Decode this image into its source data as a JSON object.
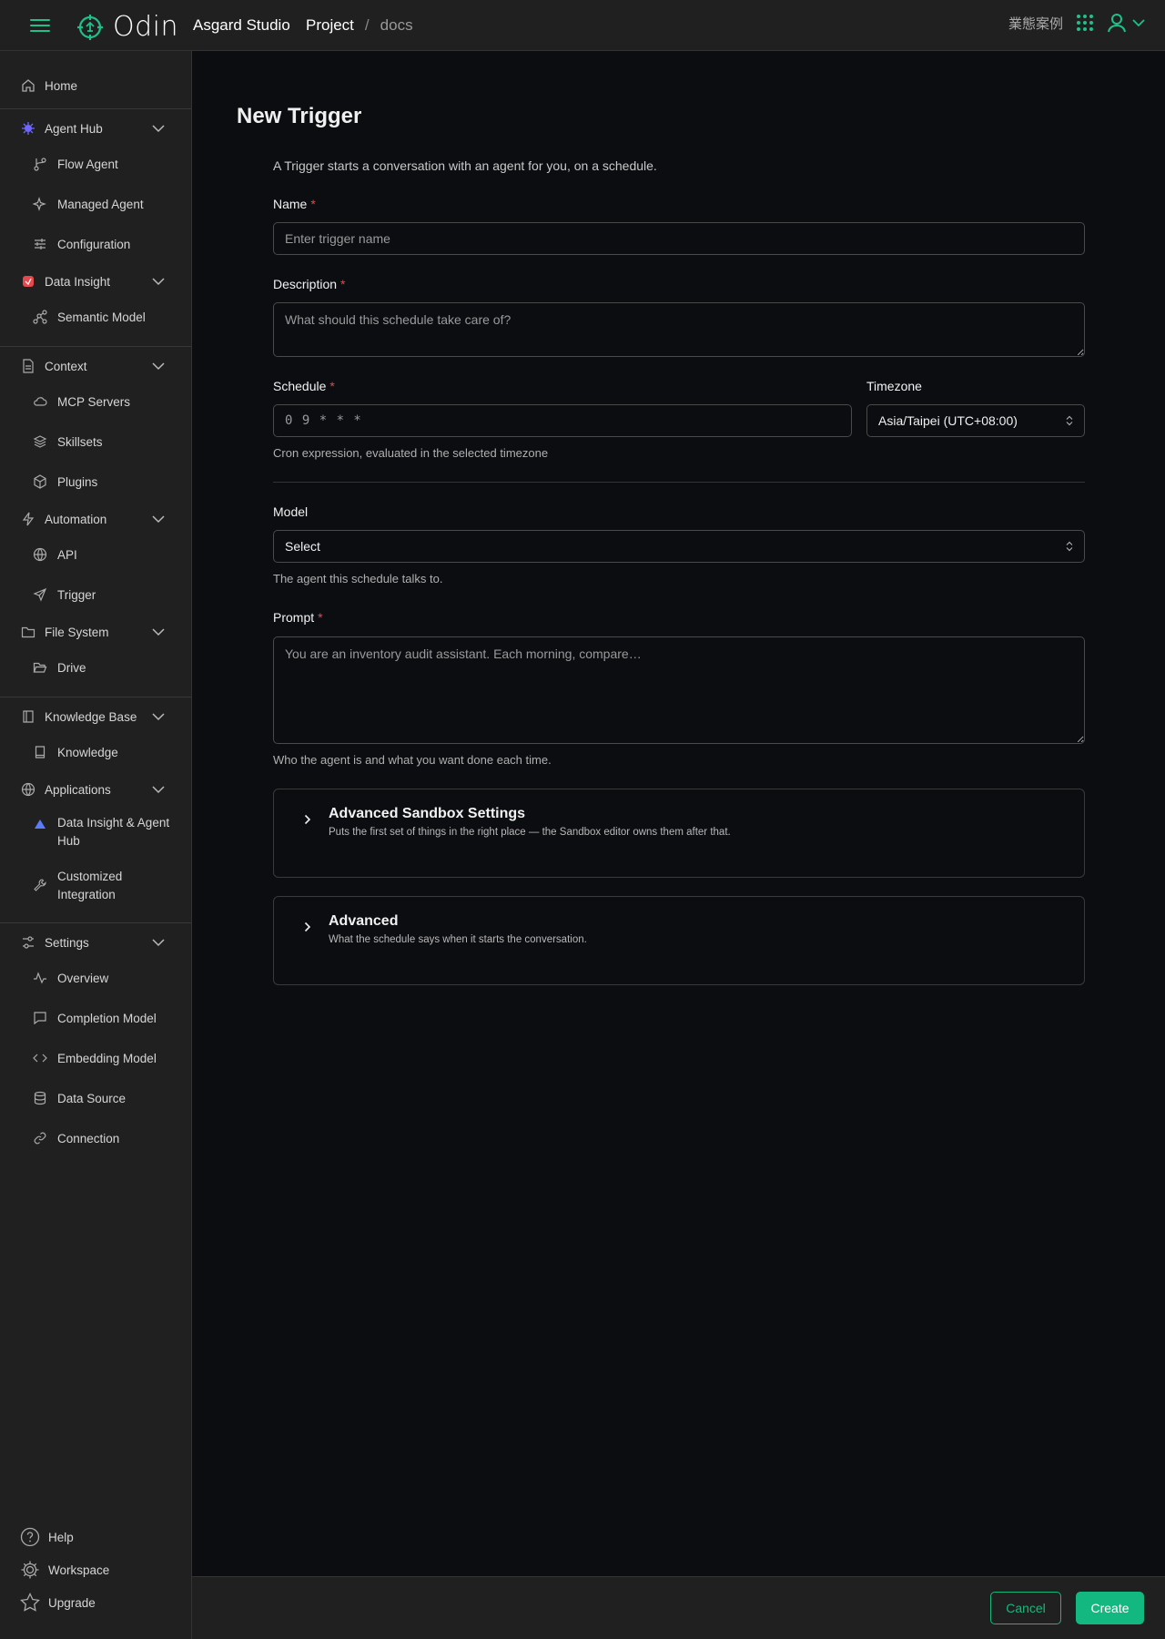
{
  "header": {
    "app_name": "Odin",
    "org_name": "Asgard Studio",
    "breadcrumb": {
      "project": "Project",
      "separator": "/",
      "current": "docs"
    },
    "case_label": "業態案例"
  },
  "sidebar": {
    "home": "Home",
    "agent_hub": {
      "label": "Agent Hub",
      "items": [
        "Flow Agent",
        "Managed Agent",
        "Configuration"
      ]
    },
    "data_insight": {
      "label": "Data Insight",
      "items": [
        "Semantic Model"
      ]
    },
    "context": {
      "label": "Context",
      "items": [
        "MCP Servers",
        "Skillsets",
        "Plugins"
      ]
    },
    "automation": {
      "label": "Automation",
      "items": [
        "API",
        "Trigger"
      ]
    },
    "file_system": {
      "label": "File System",
      "items": [
        "Drive"
      ]
    },
    "knowledge_base": {
      "label": "Knowledge Base",
      "items": [
        "Knowledge"
      ]
    },
    "applications": {
      "label": "Applications",
      "items": [
        "Data Insight & Agent Hub",
        "Customized Integration"
      ]
    },
    "settings": {
      "label": "Settings",
      "items": [
        "Overview",
        "Completion Model",
        "Embedding Model",
        "Data Source",
        "Connection"
      ]
    },
    "bottom": {
      "help": "Help",
      "workspace": "Workspace",
      "upgrade": "Upgrade"
    }
  },
  "form": {
    "title": "New Trigger",
    "intro": "A Trigger starts a conversation with an agent for you, on a schedule.",
    "name": {
      "label": "Name",
      "placeholder": "Enter trigger name"
    },
    "description": {
      "label": "Description",
      "placeholder": "What should this schedule take care of?"
    },
    "schedule": {
      "label": "Schedule",
      "value": "0 9 * * *",
      "help": "Cron expression, evaluated in the selected timezone"
    },
    "timezone": {
      "label": "Timezone",
      "value": "Asia/Taipei (UTC+08:00)"
    },
    "model": {
      "label": "Model",
      "value": "Select",
      "help": "The agent this schedule talks to."
    },
    "prompt": {
      "label": "Prompt",
      "placeholder": "You are an inventory audit assistant. Each morning, compare…",
      "help": "Who the agent is and what you want done each time."
    },
    "required_mark": "*",
    "sections": [
      {
        "title": "Advanced Sandbox Settings",
        "subtitle": "Puts the first set of things in the right place — the Sandbox editor owns them after that."
      },
      {
        "title": "Advanced",
        "subtitle": "What the schedule says when it starts the conversation."
      }
    ]
  },
  "footer": {
    "cancel": "Cancel",
    "create": "Create"
  },
  "colors": {
    "accent": "#12b880",
    "required": "#ef4444",
    "background": "#0c0d11",
    "panel": "#202020"
  }
}
